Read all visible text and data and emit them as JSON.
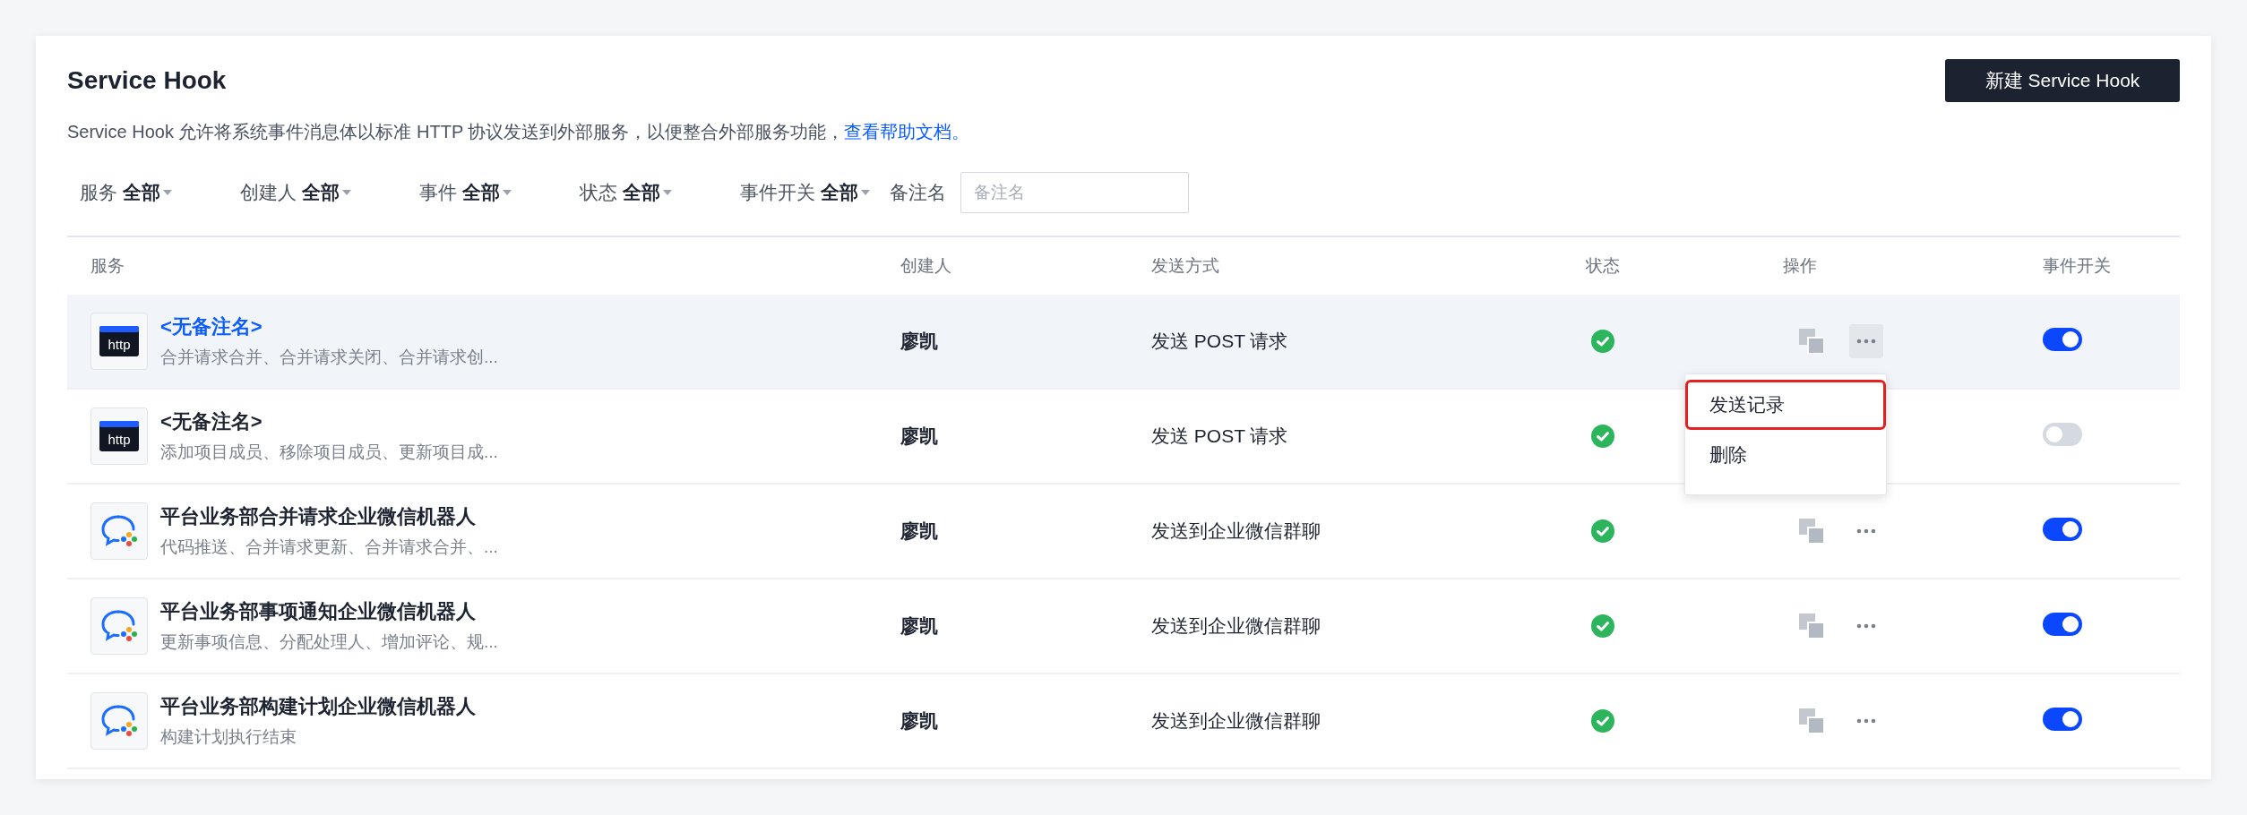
{
  "header": {
    "title": "Service Hook",
    "description": "Service Hook 允许将系统事件消息体以标准 HTTP 协议发送到外部服务，以便整合外部服务功能，",
    "help_link": "查看帮助文档。",
    "create_button": "新建 Service Hook"
  },
  "filters": [
    {
      "label": "服务",
      "value": "全部"
    },
    {
      "label": "创建人",
      "value": "全部"
    },
    {
      "label": "事件",
      "value": "全部"
    },
    {
      "label": "状态",
      "value": "全部"
    },
    {
      "label": "事件开关",
      "value": "全部"
    }
  ],
  "remark_filter": {
    "label": "备注名",
    "placeholder": "备注名"
  },
  "table": {
    "columns": [
      "服务",
      "创建人",
      "发送方式",
      "状态",
      "操作",
      "事件开关"
    ],
    "rows": [
      {
        "kind": "webhook",
        "badge": "http",
        "name": "<无备注名>",
        "events": "合并请求合并、合并请求关闭、合并请求创...",
        "creator": "廖凯",
        "method": "发送 POST 请求",
        "selected": true,
        "enabled": true,
        "menu": [
          {
            "label": "发送记录",
            "highlighted": true
          },
          {
            "label": "删除",
            "highlighted": false
          }
        ]
      },
      {
        "kind": "webhook",
        "badge": "http",
        "name": "<无备注名>",
        "events": "添加项目成员、移除项目成员、更新项目成...",
        "creator": "廖凯",
        "method": "发送 POST 请求",
        "selected": false,
        "enabled": false
      },
      {
        "kind": "chat",
        "name": "平台业务部合并请求企业微信机器人",
        "events": "代码推送、合并请求更新、合并请求合并、...",
        "creator": "廖凯",
        "method": "发送到企业微信群聊",
        "selected": false,
        "enabled": true
      },
      {
        "kind": "chat",
        "name": "平台业务部事项通知企业微信机器人",
        "events": "更新事项信息、分配处理人、增加评论、规...",
        "creator": "廖凯",
        "method": "发送到企业微信群聊",
        "selected": false,
        "enabled": true
      },
      {
        "kind": "chat",
        "name": "平台业务部构建计划企业微信机器人",
        "events": "构建计划执行结束",
        "creator": "廖凯",
        "method": "发送到企业微信群聊",
        "selected": false,
        "enabled": true
      }
    ]
  }
}
